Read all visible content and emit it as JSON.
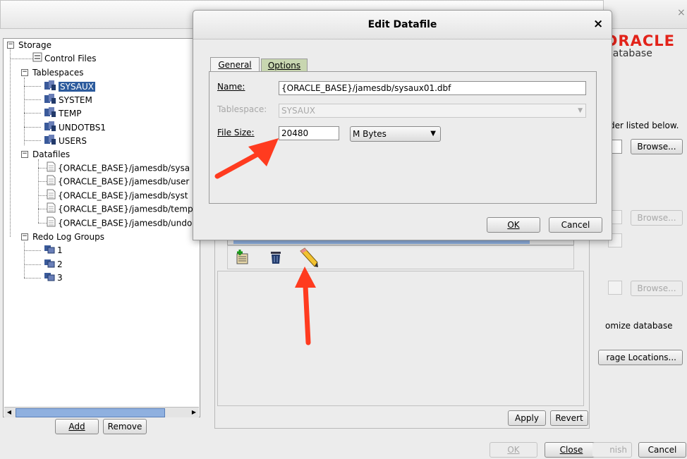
{
  "main_window": {
    "close_glyph": "×"
  },
  "oracle_logo": {
    "brand_text": "DRACLE",
    "sub_text": "Database"
  },
  "tree": {
    "root": "Storage",
    "control_files": "Control Files",
    "tablespaces_label": "Tablespaces",
    "tablespaces": [
      "SYSAUX",
      "SYSTEM",
      "TEMP",
      "UNDOTBS1",
      "USERS"
    ],
    "selected_tablespace": "SYSAUX",
    "datafiles_label": "Datafiles",
    "datafiles": [
      "{ORACLE_BASE}/jamesdb/sysa",
      "{ORACLE_BASE}/jamesdb/user",
      "{ORACLE_BASE}/jamesdb/syst",
      "{ORACLE_BASE}/jamesdb/temp",
      "{ORACLE_BASE}/jamesdb/undo"
    ],
    "redo_label": "Redo Log Groups",
    "redo_groups": [
      "1",
      "2",
      "3"
    ]
  },
  "left_buttons": {
    "add": "Add",
    "remove": "Remove"
  },
  "right_panel": {
    "listed_below_text": "der listed below.",
    "browse1": "Browse...",
    "browse2": "Browse...",
    "browse3": "Browse...",
    "mize_text": "omize database",
    "storage_locations": "rage Locations...",
    "apply": "Apply",
    "revert": "Revert"
  },
  "bottom_buttons": {
    "ok": "OK",
    "close": "Close",
    "finish_partial": "nish",
    "cancel": "Cancel"
  },
  "dialog": {
    "title": "Edit Datafile",
    "close_glyph": "×",
    "tabs": [
      "General",
      "Options"
    ],
    "active_tab": "General",
    "name_label": "Name:",
    "name_value": "{ORACLE_BASE}/jamesdb/sysaux01.dbf",
    "tablespace_label": "Tablespace:",
    "tablespace_value": "SYSAUX",
    "file_size_label": "File Size:",
    "file_size_value": "20480",
    "unit_value": "M Bytes",
    "ok": "OK",
    "cancel": "Cancel"
  },
  "colors": {
    "selection": "#2c5b9d",
    "arrow": "#ff3b1f",
    "oracle_red": "#e2231a"
  },
  "icons": [
    "add-row-icon",
    "trash-icon",
    "pencil-icon",
    "tablespace-icon",
    "datafile-icon",
    "redo-group-icon",
    "control-file-icon"
  ]
}
